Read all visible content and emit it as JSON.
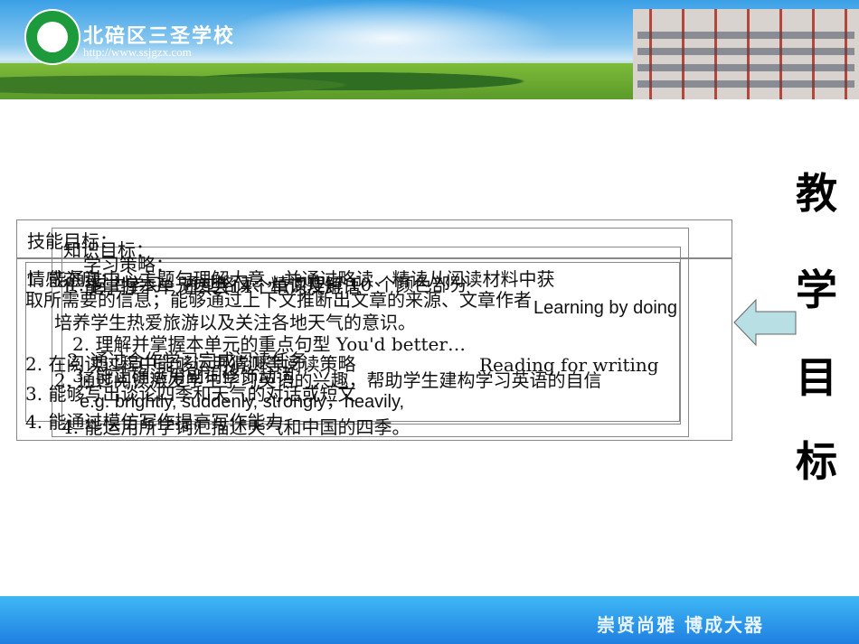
{
  "header": {
    "school_name": "北碚区三圣学校",
    "url": "http://www.ssjgzx.com"
  },
  "side_title": [
    "教",
    "学",
    "目",
    "标"
  ],
  "footer": {
    "slogan": "崇贤尚雅  博成大器"
  },
  "layers": {
    "skills": {
      "heading": "技能目标：",
      "lines": [
        "1. 能通过中心主题句理解大意，并通过略读、精读从阅读材料中获",
        "取所需要的信息；能够通过上下文推断出文章的来源、文章作者",
        "2. 在阅读过程中能够运用猜测等阅读策略",
        "3. 能够写出谈论四季和天气的对话或短文",
        "4. 能通过模仿写作提高写作能力"
      ]
    },
    "knowledge": {
      "heading": "知识目标：",
      "lines": [
        "1. 能掌握本单元四会14个单词及短语",
        "2. 理解并掌握本单元的重点句型 You'd better…",
        "3. 能正确运用副词修饰动词",
        "e.g. brightly, suddenly, strongly，heavily,",
        "4. 能运用所学词汇描述天气和中国的四季。"
      ]
    },
    "strategy": {
      "heading": "学习策略：",
      "lines": [
        "1. 自主学习：通过略读、精读理解 10 个颜色部分",
        "Learning by doing",
        "2. 通过合作学习完成阅读任务",
        "Reading for writing"
      ]
    },
    "emotion": {
      "heading": "情感态度：",
      "lines": [
        "培养学生热爱旅游以及关注各地天气的意识。",
        "2. 通过阅读激发学生学习英语的兴趣，帮助学生建构学习英语的自信"
      ]
    }
  },
  "colors": {
    "arrow": "#b7dfe4",
    "footer": "#2a94ea"
  }
}
